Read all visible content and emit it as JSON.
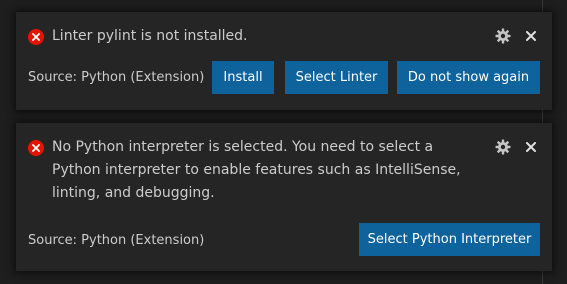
{
  "notifications": [
    {
      "message": "Linter pylint is not installed.",
      "source": "Source: Python (Extension)",
      "icon": "error-icon",
      "actions": [
        "Install",
        "Select Linter",
        "Do not show again"
      ]
    },
    {
      "message": "No Python interpreter is selected. You need to select a Python interpreter to enable features such as IntelliSense, linting, and debugging.",
      "source": "Source: Python (Extension)",
      "icon": "error-icon",
      "actions": [
        "Select Python Interpreter"
      ]
    }
  ],
  "colors": {
    "background": "#1e1e1e",
    "toast_background": "#252526",
    "button": "#0e639c",
    "error": "#e51400",
    "text": "#cccccc"
  }
}
